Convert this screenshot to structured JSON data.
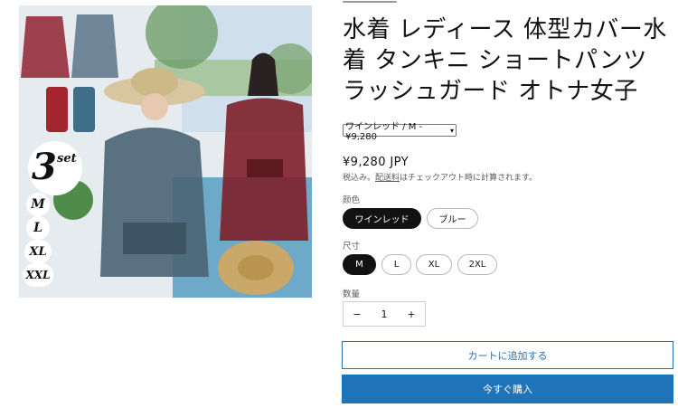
{
  "product": {
    "title": "水着 レディース 体型カバー水着 タンキニ ショートパンツ ラッシュガード オトナ女子",
    "image_badges": {
      "set_count": "3",
      "set_word": "set",
      "sizes": [
        "M",
        "L",
        "XL",
        "XXL"
      ]
    }
  },
  "variant_select": {
    "value": "ワインレッド / M - ¥9,280"
  },
  "price": "¥9,280 JPY",
  "tax_note": {
    "prefix": "税込み。",
    "link": "配送料",
    "suffix": "はチェックアウト時に計算されます。"
  },
  "color_option": {
    "label": "颜色",
    "options": [
      "ワインレッド",
      "ブルー"
    ],
    "selected": "ワインレッド"
  },
  "size_option": {
    "label": "尺寸",
    "options": [
      "M",
      "L",
      "XL",
      "2XL"
    ],
    "selected": "M"
  },
  "quantity": {
    "label": "数量",
    "minus": "−",
    "value": "1",
    "plus": "+"
  },
  "buttons": {
    "add_to_cart": "カートに追加する",
    "buy_now": "今すぐ購入"
  },
  "colors": {
    "wine": "#8e2330",
    "blue_swimsuit": "#5b7489",
    "selected_pill": "#121212",
    "buy_button": "#1f73b8"
  }
}
